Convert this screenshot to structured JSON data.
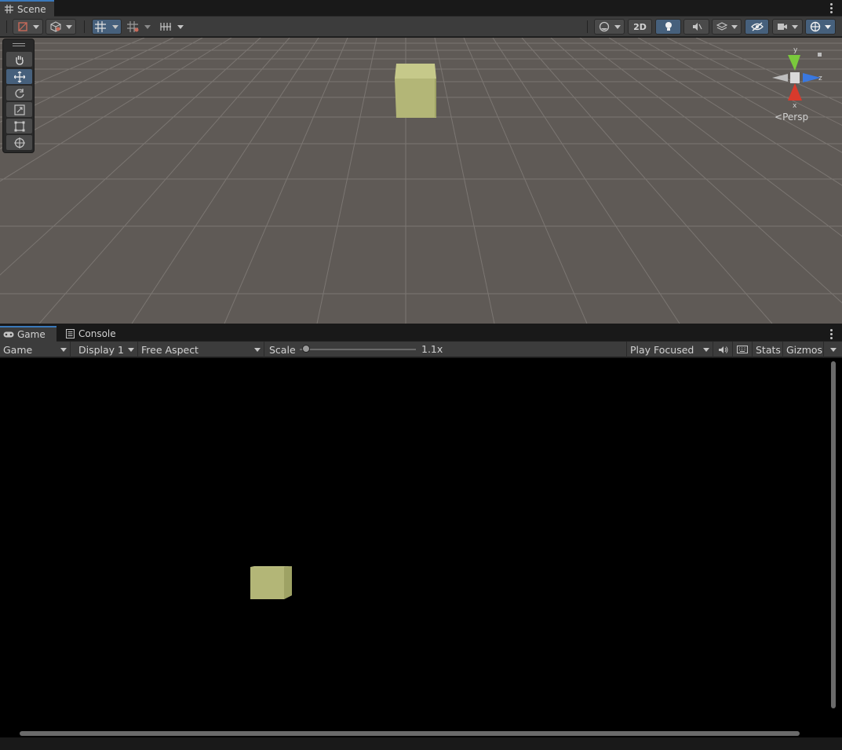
{
  "scene_panel": {
    "tab_label": "Scene",
    "toolbar": {
      "btn_2d_label": "2D"
    },
    "camera_mode_label": "Persp",
    "gizmo_axes": {
      "y": "y",
      "x": "x",
      "z": "z"
    },
    "cube_color": "#c6c98a"
  },
  "game_panel": {
    "tabs": [
      {
        "label": "Game"
      },
      {
        "label": "Console"
      }
    ],
    "toolbar": {
      "view_select": "Game",
      "display_select": "Display 1",
      "aspect_select": "Free Aspect",
      "scale_label": "Scale",
      "scale_value": "1.1x",
      "play_mode_select": "Play Focused",
      "stats_label": "Stats",
      "gizmos_label": "Gizmos"
    },
    "scale_slider_fraction": 0.05
  },
  "colors": {
    "accent_blue": "#46607c",
    "tab_highlight": "#3a79bb",
    "scene_background": "#5f5a56",
    "game_background": "#000000"
  }
}
